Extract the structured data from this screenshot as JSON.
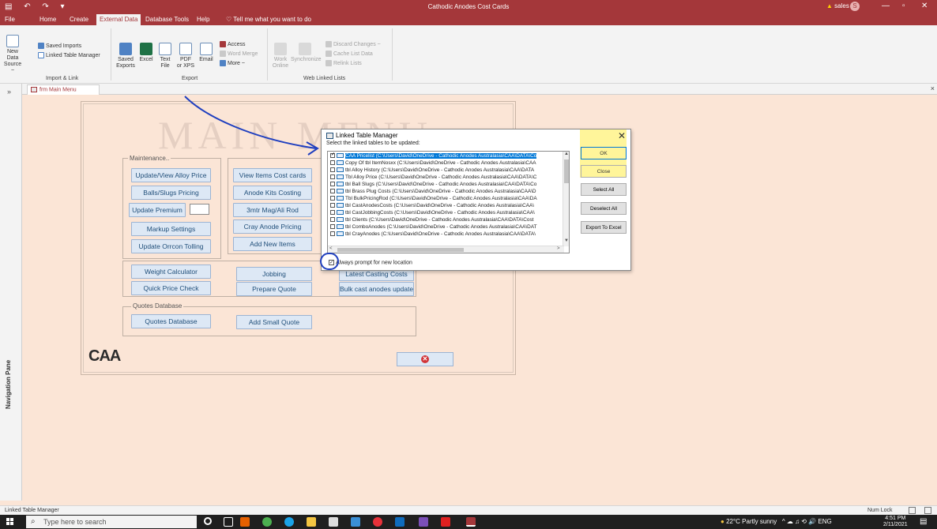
{
  "app": {
    "title": "Cathodic Anodes Cost Cards",
    "user": "sales",
    "user_initial": "S",
    "qat_icons": "▤ ↶ ↷ ▾",
    "win_min": "—",
    "win_restore": "▫",
    "win_close": "✕"
  },
  "ribbon_tabs": [
    "File",
    "Home",
    "Create",
    "External Data",
    "Database Tools",
    "Help"
  ],
  "tell_me": "Tell me what you want to do",
  "ribbon": {
    "groups": {
      "import_link": "Import & Link",
      "export": "Export",
      "web_linked": "Web Linked Lists"
    },
    "new_data_source": "New Data Source",
    "new_data_source_l1": "New Data",
    "new_data_source_l2": "Source ~",
    "saved_imports": "Saved Imports",
    "linked_table_manager": "Linked Table Manager",
    "saved_exports_l1": "Saved",
    "saved_exports_l2": "Exports",
    "excel": "Excel",
    "text_file_l1": "Text",
    "text_file_l2": "File",
    "pdf_l1": "PDF",
    "pdf_l2": "or XPS",
    "email": "Email",
    "access": "Access",
    "word_merge": "Word Merge",
    "more": "More ~",
    "work_online_l1": "Work",
    "work_online_l2": "Online",
    "synchronize": "Synchronize",
    "discard_changes": "Discard Changes ~",
    "cache_list_data": "Cache List Data",
    "relink_lists": "Relink Lists"
  },
  "nav_pane": {
    "label": "Navigation Pane",
    "chevron": "»"
  },
  "doc_tab": {
    "label": "frm Main Menu",
    "close": "×"
  },
  "main_menu": {
    "title": "MAIN MENU",
    "maintenance_label": "Maintenance..",
    "quotes_label": "Quotes Database",
    "buttons": {
      "update_alloy": "Update/View Alloy Price",
      "balls_slugs": "Balls/Slugs Pricing",
      "update_premium": "Update Premium",
      "markup": "Markup Settings",
      "orrcon": "Update Orrcon Tolling",
      "view_items": "View Items Cost cards",
      "anode_kits": "Anode Kits Costing",
      "mag_ali_rod": "3mtr Mag/Ali Rod",
      "cray_anode": "Cray Anode Pricing",
      "add_new_items": "Add New Items",
      "weight_calc": "Weight Calculator",
      "jobbing": "Jobbing",
      "latest_casting": "Latest Casting Costs",
      "quick_price": "Quick Price Check",
      "prepare_quote": "Prepare Quote",
      "bulk_cast": "Bulk cast anodes update",
      "quotes_db": "Quotes Database",
      "add_small_quote": "Add Small Quote"
    },
    "logo": "CAA",
    "exit_symbol": "✕"
  },
  "dialog": {
    "title": "Linked Table Manager",
    "instruction": "Select the linked tables to be updated:",
    "close": "✕",
    "items": [
      "CAA Pricelist  (C:\\Users\\David\\OneDrive - Cathodic Anodes Australasia\\CAA\\DATA\\Co",
      "Copy Of tbl ItemNosxx  (C:\\Users\\David\\OneDrive - Cathodic Anodes Australasia\\CAA",
      "tbl Alloy History  (C:\\Users\\David\\OneDrive - Cathodic Anodes Australasia\\CAA\\DATA",
      "Tbl Alloy Price  (C:\\Users\\David\\OneDrive - Cathodic Anodes Australasia\\CAA\\DATA\\C",
      "tbl Ball Slugs  (C:\\Users\\David\\OneDrive - Cathodic Anodes Australasia\\CAA\\DATA\\Co",
      "tbl Brass Plug Costs  (C:\\Users\\David\\OneDrive - Cathodic Anodes Australasia\\CAA\\D",
      "Tbl BulkPricingRod  (C:\\Users\\David\\OneDrive - Cathodic Anodes Australasia\\CAA\\DA",
      "tbl CastAnodesCosts  (C:\\Users\\David\\OneDrive - Cathodic Anodes Australasia\\CAA\\",
      "tbl CastJobbingCosts  (C:\\Users\\David\\OneDrive - Cathodic Anodes Australasia\\CAA\\",
      "tbl Clients  (C:\\Users\\David\\OneDrive - Cathodic Anodes Australasia\\CAA\\DATA\\Cost",
      "tbl ComboAnodes  (C:\\Users\\David\\OneDrive - Cathodic Anodes Australasia\\CAA\\DAT",
      "tbl CrayAnodes  (C:\\Users\\David\\OneDrive - Cathodic Anodes Australasia\\CAA\\DATA\\"
    ],
    "buttons": {
      "ok": "OK",
      "close": "Close",
      "select_all": "Select All",
      "deselect_all": "Deselect All",
      "export_excel": "Export To Excel"
    },
    "always_prompt": "Always prompt for new location",
    "check_mark": "✓",
    "scroll_up": "▲",
    "scroll_down": "▼",
    "scroll_left": "<",
    "scroll_right": ">"
  },
  "status_bar": {
    "left": "Linked Table Manager",
    "num_lock": "Num Lock"
  },
  "taskbar": {
    "search_placeholder": "Type here to search",
    "search_glyph": "⌕",
    "weather": "22°C  Partly sunny",
    "tray_icons": "^  ☁  ♫  ⟲ 🔊",
    "language": "ENG",
    "time": "4:51 PM",
    "date": "2/11/2021"
  },
  "colors": {
    "access_red": "#a4373a",
    "form_bg": "#fbe5d6",
    "button_bg": "#dde8f5",
    "highlight": "#fff59a",
    "selection": "#0078d7",
    "annotation": "#1f3fbf"
  }
}
